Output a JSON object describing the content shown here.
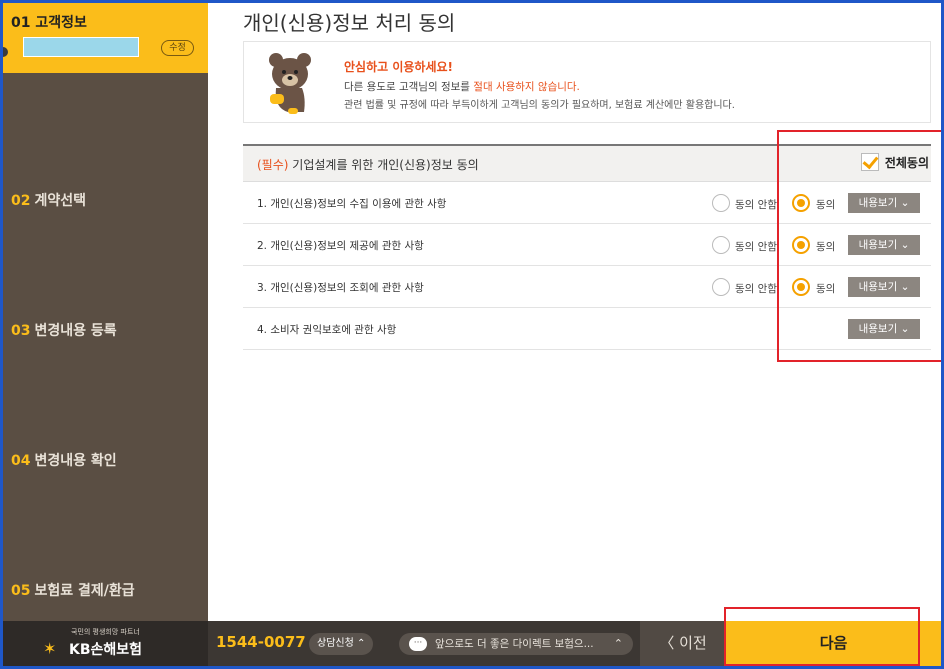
{
  "sidebar": {
    "active_step": {
      "num": "01",
      "title": "고객정보",
      "edit_label": "수정"
    },
    "steps": [
      {
        "num": "02",
        "title": "계약선택"
      },
      {
        "num": "03",
        "title": "변경내용 등록"
      },
      {
        "num": "04",
        "title": "변경내용 확인"
      },
      {
        "num": "05",
        "title": "보험료 결제/환급"
      }
    ]
  },
  "main": {
    "page_title": "개인(신용)정보 처리 동의",
    "notice": {
      "title": "안심하고 이용하세요!",
      "line1_pre": "다른 용도로 고객님의 정보를 ",
      "line1_em": "절대 사용하지 않습니다.",
      "line2": "관련 법률 및 규정에 따라 부득이하게 고객님의 동의가 필요하며, 보험료 계산에만 활용합니다."
    },
    "consent": {
      "required_tag": "(필수)",
      "title": "기업설계를 위한 개인(신용)정보 동의",
      "all_agree_label": "전체동의",
      "disagree_label": "동의 안함",
      "agree_label": "동의",
      "view_label": "내용보기 ⌄",
      "rows": [
        {
          "label": "1. 개인(신용)정보의 수집 이용에 관한 사항"
        },
        {
          "label": "2. 개인(신용)정보의 제공에 관한 사항"
        },
        {
          "label": "3. 개인(신용)정보의 조회에 관한 사항"
        },
        {
          "label": "4. 소비자 권익보호에 관한 사항"
        }
      ]
    }
  },
  "footer": {
    "logo_sub": "국민의 평생희망 파트너",
    "logo_main": "KB손해보험",
    "phone": "1544-0077",
    "consult": "상담신청 ⌃",
    "chat": "앞으로도 더 좋은 다이렉트 보험으...",
    "prev": "〈 이전",
    "next": "다음"
  }
}
